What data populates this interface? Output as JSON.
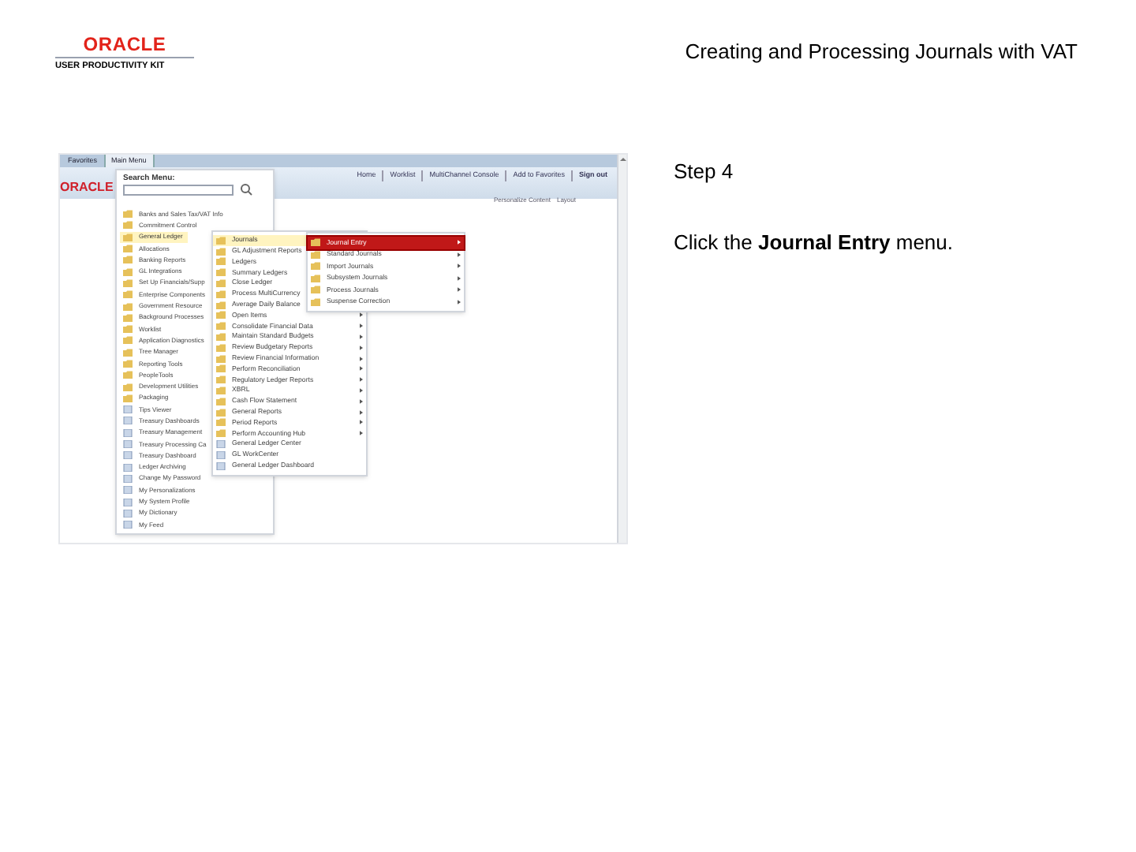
{
  "header": {
    "logo": "ORACLE",
    "logo_subtitle": "USER PRODUCTIVITY KIT",
    "title": "Creating and Processing Journals with VAT"
  },
  "app": {
    "top_menus": [
      {
        "label": "Favorites",
        "selected": false
      },
      {
        "label": "Main Menu",
        "selected": true
      }
    ],
    "brand": "ORACLE",
    "nav_links": [
      "Home",
      "Worklist",
      "MultiChannel Console",
      "Add to Favorites",
      "Sign out"
    ],
    "personalize_links": [
      "Personalize Content",
      "Layout"
    ],
    "search_label": "Search Menu:",
    "menu": [
      {
        "label": "Banks and Sales Tax/VAT Info",
        "kind": "folder",
        "selected": false
      },
      {
        "label": "Commitment Control",
        "kind": "folder",
        "selected": false
      },
      {
        "label": "General Ledger",
        "kind": "folder",
        "selected": true
      },
      {
        "label": "Allocations",
        "kind": "folder",
        "selected": false
      },
      {
        "label": "Banking Reports",
        "kind": "folder",
        "selected": false
      },
      {
        "label": "GL Integrations",
        "kind": "folder",
        "selected": false
      },
      {
        "label": "Set Up Financials/Supp",
        "kind": "folder",
        "selected": false
      },
      {
        "label": "Enterprise Components",
        "kind": "folder",
        "selected": false
      },
      {
        "label": "Government Resource",
        "kind": "folder",
        "selected": false
      },
      {
        "label": "Background Processes",
        "kind": "folder",
        "selected": false
      },
      {
        "label": "Worklist",
        "kind": "folder",
        "selected": false
      },
      {
        "label": "Application Diagnostics",
        "kind": "folder",
        "selected": false
      },
      {
        "label": "Tree Manager",
        "kind": "folder",
        "selected": false
      },
      {
        "label": "Reporting Tools",
        "kind": "folder",
        "selected": false
      },
      {
        "label": "PeopleTools",
        "kind": "folder",
        "selected": false
      },
      {
        "label": "Development Utilities",
        "kind": "folder",
        "selected": false
      },
      {
        "label": "Packaging",
        "kind": "folder",
        "selected": false
      },
      {
        "label": "Tips Viewer",
        "kind": "page",
        "selected": false
      },
      {
        "label": "Treasury Dashboards",
        "kind": "page",
        "selected": false
      },
      {
        "label": "Treasury Management",
        "kind": "page",
        "selected": false
      },
      {
        "label": "Treasury Processing Ca",
        "kind": "page",
        "selected": false
      },
      {
        "label": "Treasury Dashboard",
        "kind": "page",
        "selected": false
      },
      {
        "label": "Ledger Archiving",
        "kind": "page",
        "selected": false
      },
      {
        "label": "Change My Password",
        "kind": "page",
        "selected": false
      },
      {
        "label": "My Personalizations",
        "kind": "page",
        "selected": false
      },
      {
        "label": "My System Profile",
        "kind": "page",
        "selected": false
      },
      {
        "label": "My Dictionary",
        "kind": "page",
        "selected": false
      },
      {
        "label": "My Feed",
        "kind": "page",
        "selected": false
      }
    ],
    "submenu": [
      {
        "label": "Journals",
        "kind": "folder",
        "selected": true,
        "has_submenu": true
      },
      {
        "label": "GL Adjustment Reports",
        "kind": "folder",
        "selected": false,
        "has_submenu": true
      },
      {
        "label": "Ledgers",
        "kind": "folder",
        "selected": false,
        "has_submenu": true
      },
      {
        "label": "Summary Ledgers",
        "kind": "folder",
        "selected": false,
        "has_submenu": true
      },
      {
        "label": "Close Ledger",
        "kind": "folder",
        "selected": false,
        "has_submenu": true
      },
      {
        "label": "Process MultiCurrency",
        "kind": "folder",
        "selected": false,
        "has_submenu": true
      },
      {
        "label": "Average Daily Balance",
        "kind": "folder",
        "selected": false,
        "has_submenu": true
      },
      {
        "label": "Open Items",
        "kind": "folder",
        "selected": false,
        "has_submenu": true
      },
      {
        "label": "Consolidate Financial Data",
        "kind": "folder",
        "selected": false,
        "has_submenu": true
      },
      {
        "label": "Maintain Standard Budgets",
        "kind": "folder",
        "selected": false,
        "has_submenu": true
      },
      {
        "label": "Review Budgetary Reports",
        "kind": "folder",
        "selected": false,
        "has_submenu": true
      },
      {
        "label": "Review Financial Information",
        "kind": "folder",
        "selected": false,
        "has_submenu": true
      },
      {
        "label": "Perform Reconciliation",
        "kind": "folder",
        "selected": false,
        "has_submenu": true
      },
      {
        "label": "Regulatory Ledger Reports",
        "kind": "folder",
        "selected": false,
        "has_submenu": true
      },
      {
        "label": "XBRL",
        "kind": "folder",
        "selected": false,
        "has_submenu": true
      },
      {
        "label": "Cash Flow Statement",
        "kind": "folder",
        "selected": false,
        "has_submenu": true
      },
      {
        "label": "General Reports",
        "kind": "folder",
        "selected": false,
        "has_submenu": true
      },
      {
        "label": "Period Reports",
        "kind": "folder",
        "selected": false,
        "has_submenu": true
      },
      {
        "label": "Perform Accounting Hub",
        "kind": "folder",
        "selected": false,
        "has_submenu": true
      },
      {
        "label": "General Ledger Center",
        "kind": "page",
        "selected": false,
        "has_submenu": false
      },
      {
        "label": "GL WorkCenter",
        "kind": "page",
        "selected": false,
        "has_submenu": false
      },
      {
        "label": "General Ledger Dashboard",
        "kind": "page",
        "selected": false,
        "has_submenu": false
      }
    ],
    "subsubmenu": [
      {
        "label": "Journal Entry",
        "kind": "folder",
        "selected": true,
        "has_submenu": true
      },
      {
        "label": "Standard Journals",
        "kind": "folder",
        "selected": false,
        "has_submenu": true
      },
      {
        "label": "Import Journals",
        "kind": "folder",
        "selected": false,
        "has_submenu": true
      },
      {
        "label": "Subsystem Journals",
        "kind": "folder",
        "selected": false,
        "has_submenu": true
      },
      {
        "label": "Process Journals",
        "kind": "folder",
        "selected": false,
        "has_submenu": true
      },
      {
        "label": "Suspense Correction",
        "kind": "folder",
        "selected": false,
        "has_submenu": true
      }
    ]
  },
  "step": {
    "title": "Step 4",
    "instruction": "Click the **Journal Entry** menu."
  }
}
